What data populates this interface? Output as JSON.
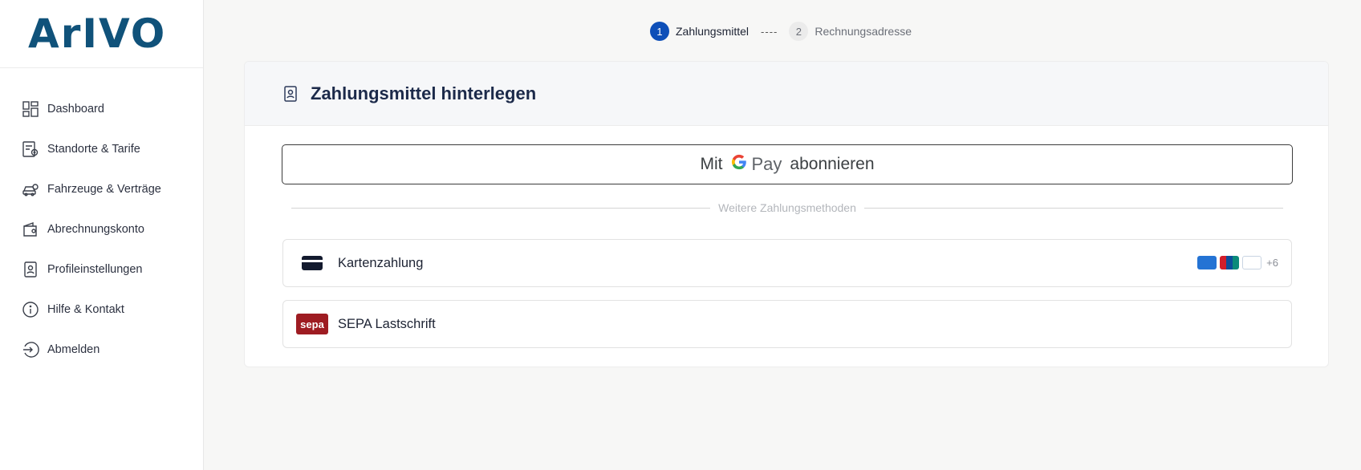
{
  "brand": {
    "logo_text": "ArIVO"
  },
  "sidebar": {
    "items": [
      {
        "label": "Dashboard",
        "icon": "dashboard-icon"
      },
      {
        "label": "Standorte & Tarife",
        "icon": "location-tariff-icon"
      },
      {
        "label": "Fahrzeuge & Verträge",
        "icon": "vehicle-contract-icon"
      },
      {
        "label": "Abrechnungskonto",
        "icon": "wallet-icon"
      },
      {
        "label": "Profileinstellungen",
        "icon": "profile-icon"
      },
      {
        "label": "Hilfe & Kontakt",
        "icon": "info-icon"
      },
      {
        "label": "Abmelden",
        "icon": "logout-icon"
      }
    ]
  },
  "stepper": {
    "steps": [
      {
        "number": "1",
        "label": "Zahlungsmittel",
        "active": true
      },
      {
        "number": "2",
        "label": "Rechnungsadresse",
        "active": false
      }
    ],
    "separator": "----"
  },
  "card": {
    "title": "Zahlungsmittel hinterlegen",
    "gpay": {
      "prefix": "Mit",
      "g": "G",
      "pay": "Pay",
      "suffix": "abonnieren"
    },
    "divider_text": "Weitere Zahlungsmethoden",
    "methods": [
      {
        "label": "Kartenzahlung",
        "icon": "credit-card-icon",
        "more_brands": "+6"
      },
      {
        "label": "SEPA Lastschrift",
        "icon": "sepa-logo",
        "logo_text": "sepa"
      }
    ]
  },
  "colors": {
    "accent": "#0e4fb8",
    "logo": "#10527a",
    "sepa": "#9e1c22"
  }
}
